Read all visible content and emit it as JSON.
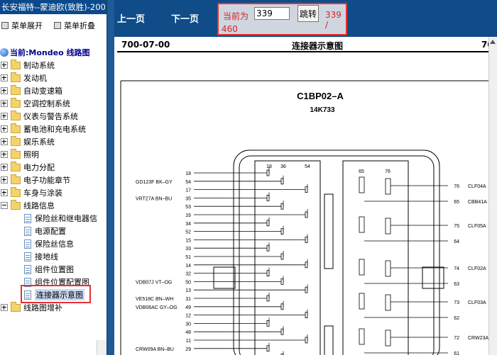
{
  "window": {
    "title": "长安福特--蒙迪欧(致胜)-2007"
  },
  "menu": {
    "expand": "菜单展开",
    "collapse": "菜单折叠"
  },
  "tree": {
    "root": "当前:Mondeo 线路图",
    "folders": [
      "制动系统",
      "发动机",
      "自动变速箱",
      "空调控制系统",
      "仪表与警告系统",
      "蓄电池和充电系统",
      "娱乐系统",
      "照明",
      "电力分配",
      "电子功能章节",
      "车身与涂装"
    ],
    "open_folder": "线路信息",
    "children": [
      "保险丝和继电器信",
      "电源配置",
      "保险丝信息",
      "接地线",
      "组件位置图",
      "组件位置配置图",
      "连接器示意图"
    ],
    "last_folder": "线路图增补"
  },
  "toolbar": {
    "prev": "上一页",
    "next": "下一页",
    "current_label": "当前为",
    "page_value": "339",
    "jump": "跳转",
    "total_a": "339 /",
    "total_b": "460"
  },
  "doc": {
    "number": "700-07-00",
    "title": "连接器示意图",
    "right": "70"
  },
  "diagram": {
    "connector": "C1BP02–A",
    "part": "14K733",
    "left_wires": [
      {
        "label": "",
        "pin": "18"
      },
      {
        "label": "GD123F BK–GY",
        "pin": "54"
      },
      {
        "label": "",
        "pin": "17"
      },
      {
        "label": "VRT27A BN–BU",
        "pin": "35"
      },
      {
        "label": "",
        "pin": "53"
      },
      {
        "label": "",
        "pin": "16"
      },
      {
        "label": "",
        "pin": "34"
      },
      {
        "label": "",
        "pin": "52"
      },
      {
        "label": "",
        "pin": "15"
      },
      {
        "label": "",
        "pin": "33"
      },
      {
        "label": "",
        "pin": "51"
      },
      {
        "label": "",
        "pin": "14"
      },
      {
        "label": "",
        "pin": "32"
      },
      {
        "label": "VDB07J VT–OG",
        "pin": "50"
      },
      {
        "label": "",
        "pin": "13"
      },
      {
        "label": "VE518C BN–WH",
        "pin": "31"
      },
      {
        "label": "VDB06AC GY–OG",
        "pin": "49"
      },
      {
        "label": "",
        "pin": "12"
      },
      {
        "label": "",
        "pin": "30"
      },
      {
        "label": "",
        "pin": "48"
      },
      {
        "label": "",
        "pin": "11"
      },
      {
        "label": "CRW09A BN–BU",
        "pin": "29"
      },
      {
        "label": "CRW04A YE–GN",
        "pin": "47"
      }
    ],
    "left_header_pins": [
      "18",
      "36",
      "54"
    ],
    "right_header_pins": [
      "65",
      "76"
    ],
    "right_wires": [
      {
        "pin": "76",
        "label": "CLF04A"
      },
      {
        "pin": "65",
        "label": "CBB41A"
      },
      {
        "pin": "75",
        "label": "CLF05A"
      },
      {
        "pin": "64",
        "label": ""
      },
      {
        "pin": "74",
        "label": "CLF02A"
      },
      {
        "pin": "63",
        "label": ""
      },
      {
        "pin": "73",
        "label": "CLF03A"
      },
      {
        "pin": "62",
        "label": ""
      },
      {
        "pin": "72",
        "label": "CRW23A"
      },
      {
        "pin": "61",
        "label": ""
      }
    ]
  }
}
